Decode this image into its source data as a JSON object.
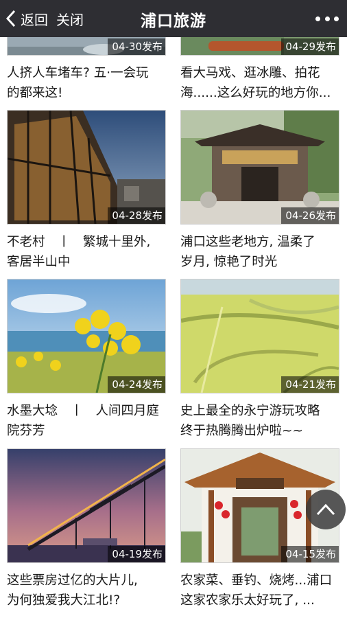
{
  "nav": {
    "back_label": "返回",
    "close_label": "关闭",
    "title": "浦口旅游"
  },
  "articles": [
    {
      "date": "04-30发布",
      "title": "人挤人车堵车? 五·一会玩\n的都来这!",
      "thumb": "road"
    },
    {
      "date": "04-29发布",
      "title": "看大马戏、逛冰雕、拍花\n海......这么好玩的地方你...",
      "thumb": "boat"
    },
    {
      "date": "04-28发布",
      "title": "不老村　丨　繁城十里外,\n客居半山中",
      "thumb": "glass-house"
    },
    {
      "date": "04-26发布",
      "title": "浦口这些老地方, 温柔了\n岁月, 惊艳了时光",
      "thumb": "temple-gate"
    },
    {
      "date": "04-24发布",
      "title": "水墨大埝　丨　人间四月庭\n院芬芳",
      "thumb": "rapeseed"
    },
    {
      "date": "04-21发布",
      "title": "史上最全的永宁游玩攻略\n终于热腾腾出炉啦~~",
      "thumb": "fields"
    },
    {
      "date": "04-19发布",
      "title": "这些票房过亿的大片儿,\n为何独爱我大江北!?",
      "thumb": "bridge"
    },
    {
      "date": "04-15发布",
      "title": "农家菜、垂钓、烧烤...浦口\n这家农家乐太好玩了, ...",
      "thumb": "farmhouse"
    }
  ],
  "icons": {
    "back": "chevron-left-icon",
    "more": "more-dots-icon",
    "scroll_top": "chevron-up-icon"
  },
  "colors": {
    "topbar": "#2e2e33",
    "date_badge": "rgba(0,0,0,0.55)",
    "title_text": "#1a1a1a"
  }
}
